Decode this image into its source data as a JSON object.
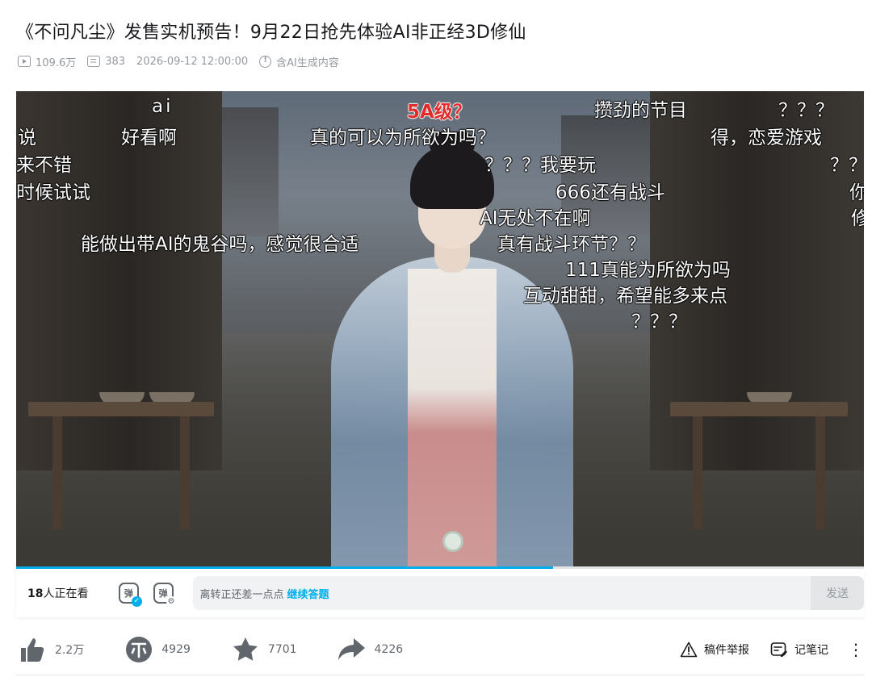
{
  "video": {
    "title": "《不问凡尘》发售实机预告！9月22日抢先体验AI非正经3D修仙",
    "views": "109.6万",
    "danmaku_count": "383",
    "datetime": "2026-09-12 12:00:00",
    "ai_notice": "含AI生成内容"
  },
  "danmaku": [
    {
      "text": "ai",
      "red": false
    },
    {
      "text": "5A级？",
      "red": true
    },
    {
      "text": "攒劲的节目",
      "red": false
    },
    {
      "text": "？？？",
      "red": false
    },
    {
      "text": "说",
      "red": false
    },
    {
      "text": "好看啊",
      "red": false
    },
    {
      "text": "真的可以为所欲为吗？",
      "red": false
    },
    {
      "text": "得，恋爱游戏",
      "red": false
    },
    {
      "text": "来不错",
      "red": false
    },
    {
      "text": "？？？我要玩",
      "red": false
    },
    {
      "text": "？？",
      "red": false
    },
    {
      "text": "时候试试",
      "red": false
    },
    {
      "text": "666还有战斗",
      "red": false
    },
    {
      "text": "你",
      "red": false
    },
    {
      "text": "AI无处不在啊",
      "red": false
    },
    {
      "text": "修",
      "red": false
    },
    {
      "text": "能做出带AI的鬼谷吗，感觉很合适",
      "red": false
    },
    {
      "text": "真有战斗环节？？",
      "red": false
    },
    {
      "text": "111真能为所欲为吗",
      "red": false
    },
    {
      "text": "互动甜甜，希望能多来点",
      "red": false
    },
    {
      "text": "？？？",
      "red": false
    }
  ],
  "player": {
    "progress_fraction": 0.633
  },
  "sendbar": {
    "viewers_count": "18",
    "viewers_suffix": "人正在看",
    "danmaku_toggle_glyph": "弹",
    "danmaku_settings_glyph": "弹",
    "input_hint": "离转正还差一点点",
    "input_link": "继续答题",
    "send_label": "发送"
  },
  "actions": {
    "like": "2.2万",
    "coin": "4929",
    "favorite": "7701",
    "share": "4226",
    "report": "稿件举报",
    "notes": "记笔记",
    "more": "⋮"
  },
  "colors": {
    "accent": "#00aeec",
    "icon": "#18191c",
    "muted": "#9499a0"
  },
  "icons": [
    "play-icon",
    "danmaku-icon",
    "ai-notice-icon",
    "like-icon",
    "coin-icon",
    "favorite-icon",
    "share-icon",
    "report-icon",
    "notes-icon",
    "more-icon"
  ]
}
